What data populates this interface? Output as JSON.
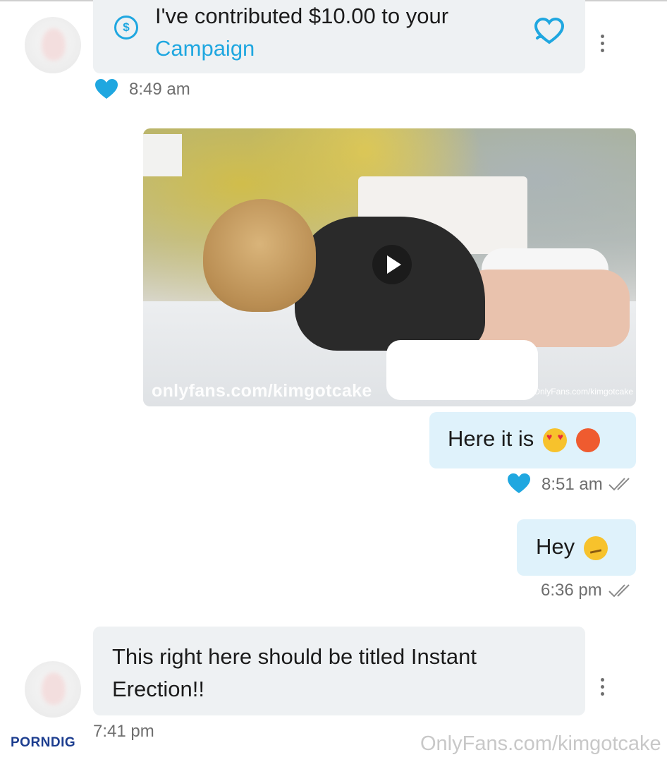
{
  "messages": [
    {
      "type": "tip",
      "text_line1": "I've contributed $10.00 to your",
      "text_link": "Campaign",
      "time": "8:49 am"
    },
    {
      "type": "video",
      "watermark_large": "onlyfans.com/kimgotcake",
      "watermark_small": "OnlyFans.com/kimgotcake"
    },
    {
      "type": "outgoing",
      "text": "Here it is",
      "time": "8:51 am"
    },
    {
      "type": "outgoing",
      "text": "Hey",
      "time": "6:36 pm"
    },
    {
      "type": "incoming",
      "text_line1": "This right here should be titled Instant",
      "text_line2": "Erection!!",
      "time": "7:41 pm"
    }
  ],
  "footer": {
    "brand_part1": "PORN",
    "brand_part2": "DIG",
    "watermark": "OnlyFans.com/kimgotcake"
  },
  "colors": {
    "accent": "#1fa7e0",
    "incoming_bubble": "#eef1f3",
    "outgoing_bubble": "#dff2fb"
  },
  "icons": [
    "dollar-icon",
    "heart-outline-icon",
    "kebab-icon",
    "heart-filled-icon",
    "double-check-icon",
    "play-icon"
  ]
}
